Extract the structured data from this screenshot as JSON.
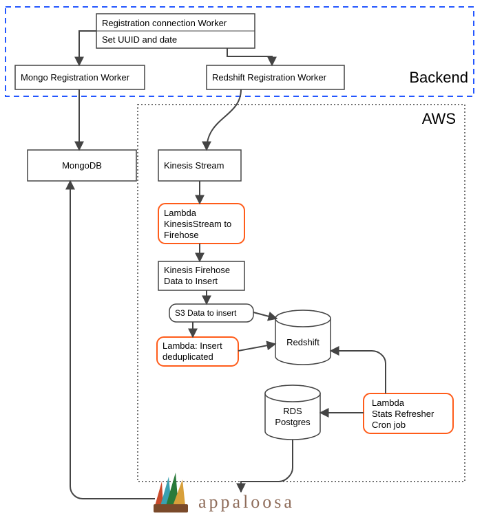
{
  "zones": {
    "backend_label": "Backend",
    "aws_label": "AWS"
  },
  "nodes": {
    "reg_conn_worker": "Registration connection Worker",
    "reg_conn_sub": "Set UUID and date",
    "mongo_worker": "Mongo Registration Worker",
    "redshift_worker": "Redshift Registration Worker",
    "mongodb": "MongoDB",
    "kinesis_stream": "Kinesis Stream",
    "lambda_ks_line1": "Lambda",
    "lambda_ks_line2": "KinesisStream to",
    "lambda_ks_line3": "Firehose",
    "kinesis_fh_line1": "Kinesis Firehose",
    "kinesis_fh_line2": "Data to Insert",
    "s3_data": "S3 Data to insert",
    "lambda_dedup_line1": "Lambda: Insert",
    "lambda_dedup_line2": "deduplicated",
    "redshift": "Redshift",
    "rds_line1": "RDS",
    "rds_line2": "Postgres",
    "lambda_stats_line1": "Lambda",
    "lambda_stats_line2": "Stats Refresher",
    "lambda_stats_line3": "Cron job",
    "appaloosa": "appaloosa"
  },
  "colors": {
    "orange": "#ff5c1a",
    "blue_dash": "#2356ff",
    "gray_stroke": "#444444",
    "light_stroke": "#888888"
  }
}
